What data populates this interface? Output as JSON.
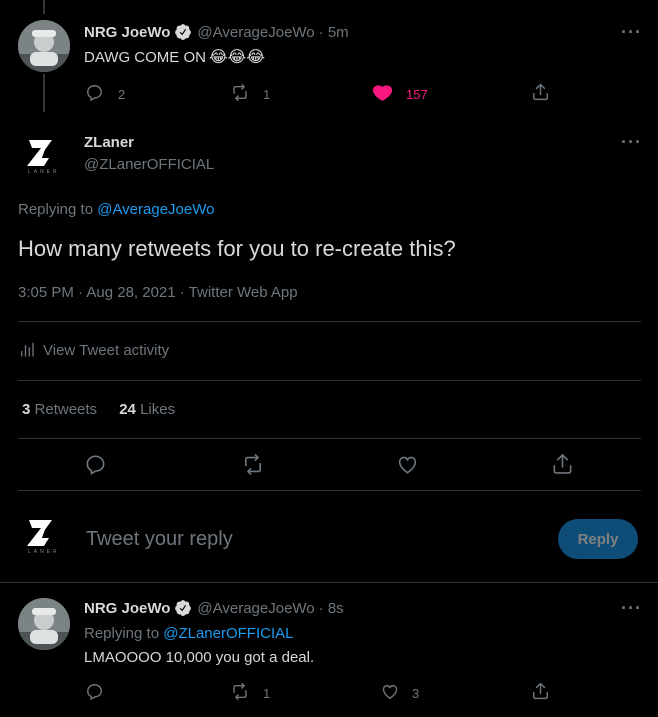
{
  "tweet1": {
    "name": "NRG JoeWo",
    "handle": "@AverageJoeWo",
    "time": "· 5m",
    "text": "DAWG COME ON",
    "emoji": "😂😂😂",
    "replies": "2",
    "retweets": "1",
    "likes": "157"
  },
  "main": {
    "name": "ZLaner",
    "handle": "@ZLanerOFFICIAL",
    "logo_sub": "LANER",
    "replying_prefix": "Replying to ",
    "replying_to": "@AverageJoeWo",
    "text": "How many retweets for you to re-create this?",
    "meta": "3:05 PM · Aug 28, 2021 · Twitter Web App",
    "activity": "View Tweet activity",
    "retweet_count": "3",
    "retweet_label": "Retweets",
    "like_count": "24",
    "like_label": "Likes"
  },
  "composer": {
    "placeholder": "Tweet your reply",
    "button": "Reply"
  },
  "tweet2": {
    "name": "NRG JoeWo",
    "handle": "@AverageJoeWo",
    "time": "· 8s",
    "replying_prefix": "Replying to ",
    "replying_to": "@ZLanerOFFICIAL",
    "text": "LMAOOOO 10,000 you got a deal.",
    "retweets": "1",
    "likes": "3"
  },
  "colors": {
    "background": "#000000",
    "accent": "#1d9bf0",
    "like": "#f91880",
    "divider": "#2f3336",
    "muted": "#6e767d"
  }
}
